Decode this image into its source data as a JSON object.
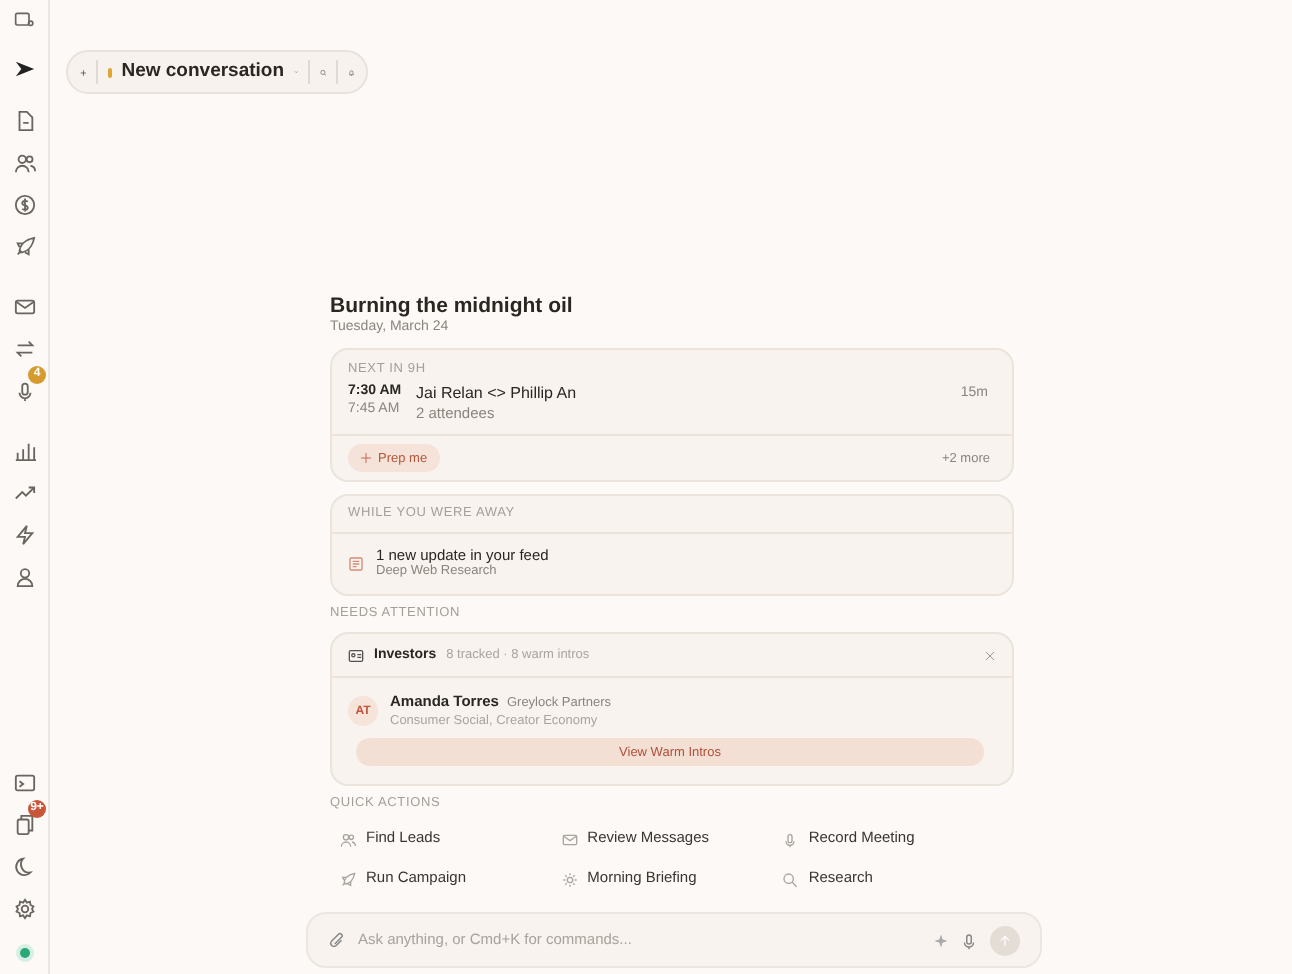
{
  "top_bar": {
    "title": "New conversation"
  },
  "sidebar_badges": [
    {
      "text": "4",
      "color": "#d69a2d"
    },
    {
      "text": "9+",
      "color": "#c8573a"
    }
  ],
  "greeting": {
    "title": "Burning the midnight oil",
    "date": "Tuesday, March 24"
  },
  "next_meeting": {
    "heading": "NEXT IN 9H",
    "start": "7:30 AM",
    "end": "7:45 AM",
    "title": "Jai Relan <> Phillip An",
    "attendees": "2 attendees",
    "duration": "15m",
    "action": "Prep me",
    "more": "+2 more"
  },
  "away": {
    "heading": "WHILE YOU WERE AWAY",
    "title": "1 new update in your feed",
    "source": "Deep Web Research"
  },
  "needs_attention": {
    "heading": "NEEDS ATTENTION",
    "group": "Investors",
    "summary": "8 tracked · 8 warm intros",
    "initials": "AT",
    "name": "Amanda Torres",
    "firm": "Greylock Partners",
    "tags": "Consumer Social, Creator Economy",
    "button": "View Warm Intros"
  },
  "quick_actions": {
    "heading": "QUICK ACTIONS",
    "items": [
      "Find Leads",
      "Review Messages",
      "Record Meeting",
      "Run Campaign",
      "Morning Briefing",
      "Research"
    ]
  },
  "composer": {
    "placeholder": "Ask anything, or Cmd+K for commands..."
  }
}
